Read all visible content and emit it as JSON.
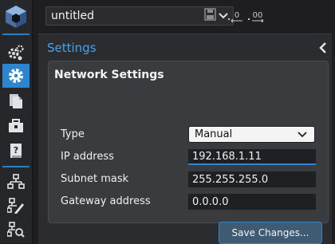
{
  "toolbar": {
    "filename": "untitled",
    "icons": [
      "chevron-down-icon",
      "save-icon",
      "decrease-decimals-icon",
      "increase-decimals-icon"
    ]
  },
  "sidebar": {
    "items": [
      {
        "name": "settings-cogs-icon",
        "active": false
      },
      {
        "name": "settings-gear-icon",
        "active": true
      },
      {
        "name": "documents-icon",
        "active": false
      },
      {
        "name": "toolbox-icon",
        "active": false
      },
      {
        "name": "help-manual-icon",
        "active": false
      },
      {
        "name": "network-icon",
        "active": false
      },
      {
        "name": "network-edit-icon",
        "active": false
      },
      {
        "name": "network-search-icon",
        "active": false
      }
    ]
  },
  "panel": {
    "title": "Settings",
    "card_title": "Network Settings",
    "fields": {
      "type": {
        "label": "Type",
        "value": "Manual"
      },
      "ip": {
        "label": "IP address",
        "value": "192.168.1.11"
      },
      "subnet": {
        "label": "Subnet mask",
        "value": "255.255.255.0"
      },
      "gateway": {
        "label": "Gateway address",
        "value": "0.0.0.0"
      }
    },
    "save_label": "Save Changes..."
  },
  "colors": {
    "accent": "#2f86cf",
    "title_blue": "#4aa3e8",
    "background": "#1e1e20",
    "panel": "#2b2c30",
    "card": "#3a3b3f"
  }
}
